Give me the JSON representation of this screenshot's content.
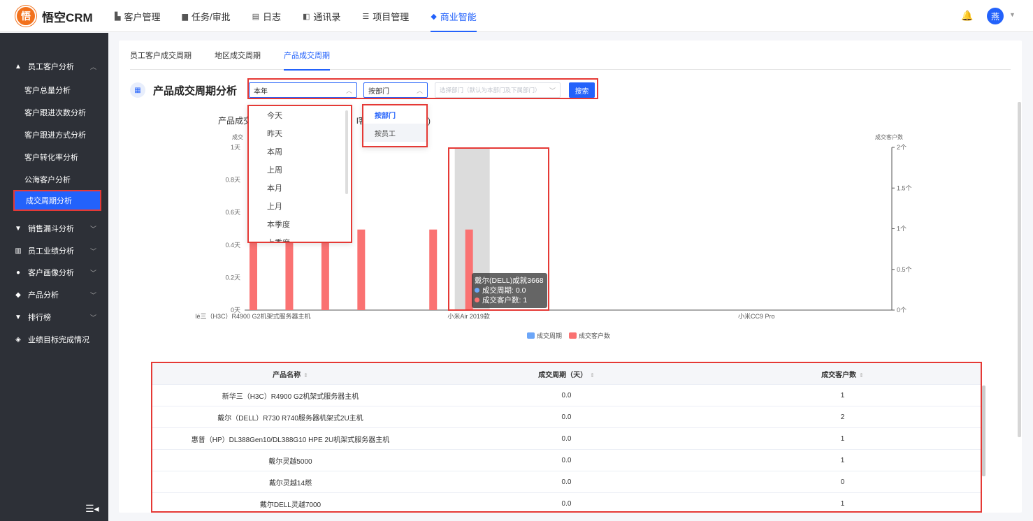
{
  "app": {
    "logo_glyph": "悟",
    "name": "悟空CRM"
  },
  "nav": [
    {
      "icon": "building-icon",
      "glyph": "▙",
      "label": "客户管理",
      "active": false
    },
    {
      "icon": "briefcase-icon",
      "glyph": "▆",
      "label": "任务/审批",
      "active": false
    },
    {
      "icon": "journal-icon",
      "glyph": "▤",
      "label": "日志",
      "active": false
    },
    {
      "icon": "contacts-icon",
      "glyph": "◧",
      "label": "通讯录",
      "active": false
    },
    {
      "icon": "list-icon",
      "glyph": "☰",
      "label": "项目管理",
      "active": false
    },
    {
      "icon": "bi-icon",
      "glyph": "◆",
      "label": "商业智能",
      "active": true
    }
  ],
  "header": {
    "bell_icon": "bell-icon",
    "avatar_text": "燕"
  },
  "sidebar": {
    "groups": [
      {
        "icon": "person-icon",
        "glyph": "▲",
        "label": "员工客户分析",
        "chev": "︿"
      },
      {
        "icon": "funnel-icon",
        "glyph": "▼",
        "label": "销售漏斗分析",
        "chev": "﹀"
      },
      {
        "icon": "bar-icon",
        "glyph": "▥",
        "label": "员工业绩分析",
        "chev": "﹀"
      },
      {
        "icon": "people-icon",
        "glyph": "●",
        "label": "客户画像分析",
        "chev": "﹀"
      },
      {
        "icon": "box-icon",
        "glyph": "◆",
        "label": "产品分析",
        "chev": "﹀"
      },
      {
        "icon": "trophy-icon",
        "glyph": "▼",
        "label": "排行榜",
        "chev": "﹀"
      },
      {
        "icon": "target-icon",
        "glyph": "◈",
        "label": "业绩目标完成情况",
        "chev": ""
      }
    ],
    "subitems": [
      "客户总量分析",
      "客户跟进次数分析",
      "客户跟进方式分析",
      "客户转化率分析",
      "公海客户分析",
      "成交周期分析"
    ],
    "collapse_glyph": "☰◂"
  },
  "tabs": [
    "员工客户成交周期",
    "地区成交周期",
    "产品成交周期"
  ],
  "section": {
    "title": "产品成交周期分析",
    "icon_glyph": "▦"
  },
  "filters": {
    "time_value": "本年",
    "group_value": "按部门",
    "dept_placeholder": "选择部门（默认为本部门及下属部门）",
    "search_label": "搜索",
    "caret_up": "︿",
    "caret_down": "﹀"
  },
  "time_options": [
    "今天",
    "昨天",
    "本周",
    "上周",
    "本月",
    "上月",
    "本季度",
    "上季度"
  ],
  "group_options": [
    "按部门",
    "按员工"
  ],
  "tooltip": {
    "title": "戴尔(DELL)成就3668",
    "row1": "成交周期: 0.0",
    "row2": "成交客户数: 1",
    "color1": "#6ca6f8",
    "color2": "#fa7272"
  },
  "chart_data": {
    "type": "bar",
    "title": "产品成交周期",
    "title_right": ")",
    "title_mid": "l客",
    "ylabel_left": "成交",
    "ylabel_right": "成交客户数",
    "yticks_left": [
      "0天",
      "0.2天",
      "0.4天",
      "0.6天",
      "0.8天",
      "1天"
    ],
    "yticks_right": [
      "0个",
      "0.5个",
      "1个",
      "1.5个",
      "2个"
    ],
    "ylim_left": [
      0,
      1
    ],
    "ylim_right": [
      0,
      2
    ],
    "xtick_labels": [
      "lé三（H3C）R4900 G2机架式服务器主机",
      "小米Air 2019款",
      "小米CC9 Pro"
    ],
    "xtick_category_index": [
      0,
      6,
      14
    ],
    "category_count": 18,
    "series": [
      {
        "name": "成交周期",
        "color": "#6ca6f8",
        "values": [
          0,
          0,
          0,
          0,
          0,
          0,
          0
        ]
      },
      {
        "name": "成交客户数",
        "color": "#fa7272",
        "values": [
          1,
          0.85,
          0.85,
          0.85,
          0.85,
          0.85,
          0.85
        ]
      }
    ],
    "bar_values_right": [
      0.85,
      0.85,
      0.85,
      0.99,
      0.99,
      0.99
    ],
    "bar_category_index": [
      0,
      1,
      2,
      3,
      5,
      6
    ],
    "highlight_category": 6,
    "legend_position": "bottom"
  },
  "table": {
    "columns": [
      "产品名称",
      "成交周期（天）",
      "成交客户数"
    ],
    "sort_glyph": "⇕",
    "rows": [
      [
        "新华三（H3C）R4900 G2机架式服务器主机",
        "0.0",
        "1"
      ],
      [
        "戴尔（DELL）R730 R740服务器机架式2U主机",
        "0.0",
        "2"
      ],
      [
        "惠普（HP）DL388Gen10/DL388G10 HPE 2U机架式服务器主机",
        "0.0",
        "1"
      ],
      [
        "戴尔灵越5000",
        "0.0",
        "1"
      ],
      [
        "戴尔灵越14燃",
        "0.0",
        "0"
      ],
      [
        "戴尔DELL灵越7000",
        "0.0",
        "1"
      ]
    ]
  }
}
